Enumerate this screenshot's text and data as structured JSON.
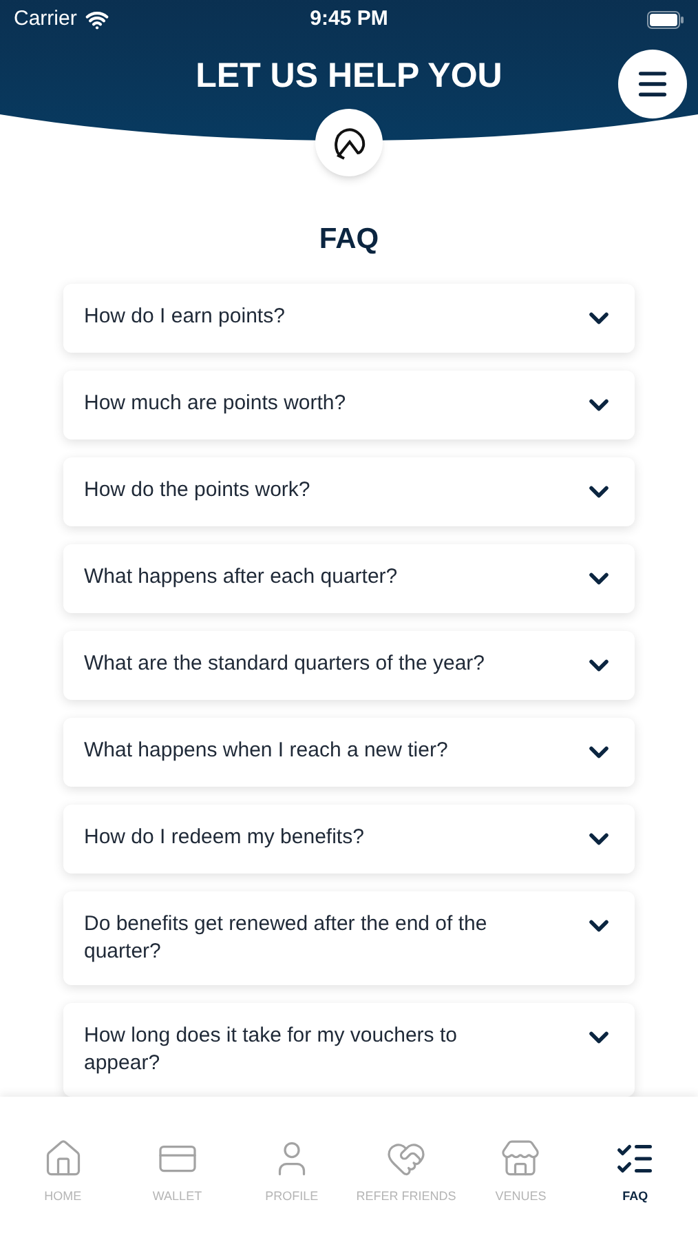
{
  "status_bar": {
    "carrier": "Carrier",
    "time": "9:45 PM"
  },
  "header": {
    "title": "LET US HELP YOU"
  },
  "section_title": "FAQ",
  "faq": [
    {
      "question": "How do I earn points?",
      "expanded": false
    },
    {
      "question": "How much are points worth?",
      "expanded": false
    },
    {
      "question": "How do the points work?",
      "expanded": false
    },
    {
      "question": "What happens after each quarter?",
      "expanded": false
    },
    {
      "question": "What are the standard quarters of the year?",
      "expanded": false
    },
    {
      "question": "What happens when I reach a new tier?",
      "expanded": false
    },
    {
      "question": "How do I redeem my benefits?",
      "expanded": false
    },
    {
      "question": "Do benefits get renewed after the end of the quarter?",
      "expanded": false
    },
    {
      "question": "How long does it take for my vouchers to appear?",
      "expanded": false
    }
  ],
  "tab_bar": [
    {
      "kind": "home",
      "label": "HOME",
      "selected": false
    },
    {
      "kind": "wallet",
      "label": "WALLET",
      "selected": false
    },
    {
      "kind": "profile",
      "label": "PROFILE",
      "selected": false
    },
    {
      "kind": "refer",
      "label": "REFER FRIENDS",
      "selected": false
    },
    {
      "kind": "venues",
      "label": "VENUES",
      "selected": false
    },
    {
      "kind": "faq",
      "label": "FAQ",
      "selected": true
    }
  ]
}
